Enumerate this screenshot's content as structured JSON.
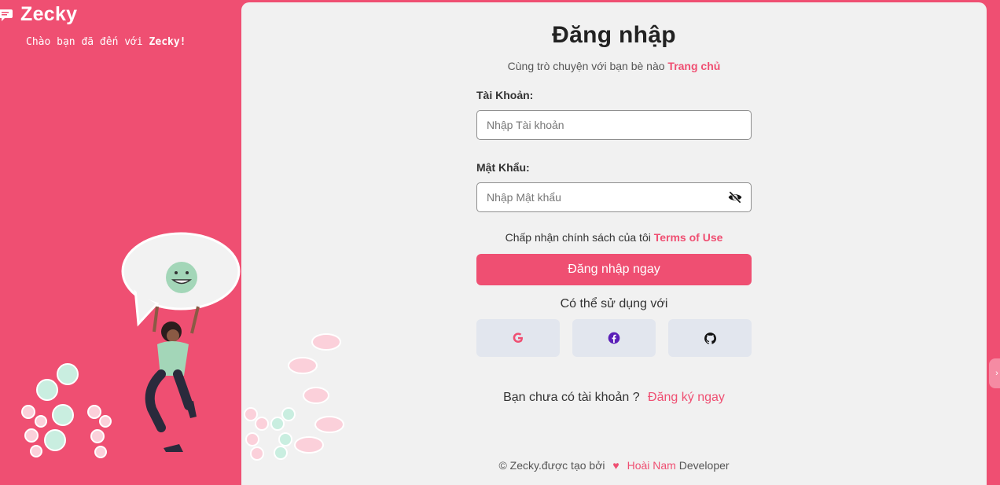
{
  "brand": {
    "name": "Zecky",
    "welcome_prefix": "Chào bạn đã đến với",
    "welcome_name": "Zecky!"
  },
  "form": {
    "title": "Đăng nhập",
    "subtitle": "Cùng trò chuyện với bạn bè nào",
    "home_link": "Trang chủ",
    "username_label": "Tài Khoản:",
    "username_placeholder": "Nhập Tài khoản",
    "password_label": "Mật Khẩu:",
    "password_placeholder": "Nhập Mật khẩu",
    "terms_text": "Chấp nhận chính sách của tôi",
    "terms_link": "Terms of Use",
    "login_button": "Đăng nhập ngay",
    "social_text": "Có thể sử dụng với",
    "socials": [
      "google-icon",
      "facebook-icon",
      "github-icon"
    ],
    "register_text": "Bạn chưa có tài khoản ?",
    "register_link": "Đăng ký ngay"
  },
  "footer": {
    "prefix": "© Zecky.được tạo bởi",
    "author": "Hoài Nam",
    "suffix": "Developer"
  },
  "colors": {
    "primary": "#ef4f72",
    "card": "#f1f1f1",
    "social_bg": "#e2e6ee",
    "facebook": "#5b1fb8"
  }
}
